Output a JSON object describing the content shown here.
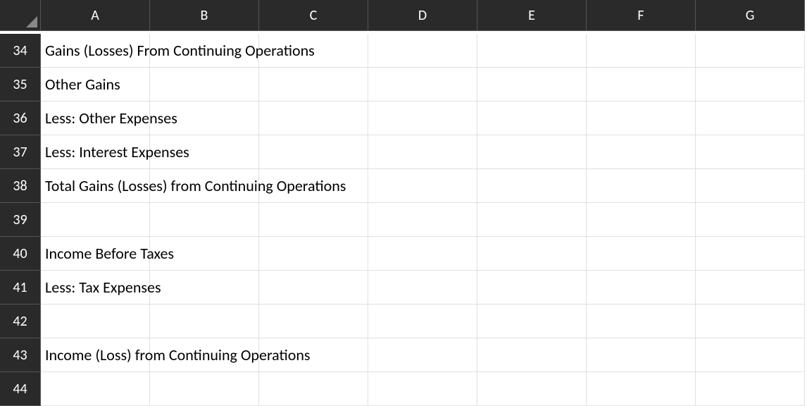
{
  "columns": [
    "A",
    "B",
    "C",
    "D",
    "E",
    "F",
    "G"
  ],
  "rows": [
    {
      "num": "34",
      "a": "Gains (Losses) From Continuing Operations"
    },
    {
      "num": "35",
      "a": "Other Gains"
    },
    {
      "num": "36",
      "a": "Less: Other Expenses"
    },
    {
      "num": "37",
      "a": "Less: Interest Expenses"
    },
    {
      "num": "38",
      "a": "Total Gains (Losses) from Continuing Operations"
    },
    {
      "num": "39",
      "a": ""
    },
    {
      "num": "40",
      "a": "Income Before Taxes"
    },
    {
      "num": "41",
      "a": "Less: Tax Expenses"
    },
    {
      "num": "42",
      "a": ""
    },
    {
      "num": "43",
      "a": "Income (Loss) from Continuing Operations"
    },
    {
      "num": "44",
      "a": ""
    }
  ]
}
